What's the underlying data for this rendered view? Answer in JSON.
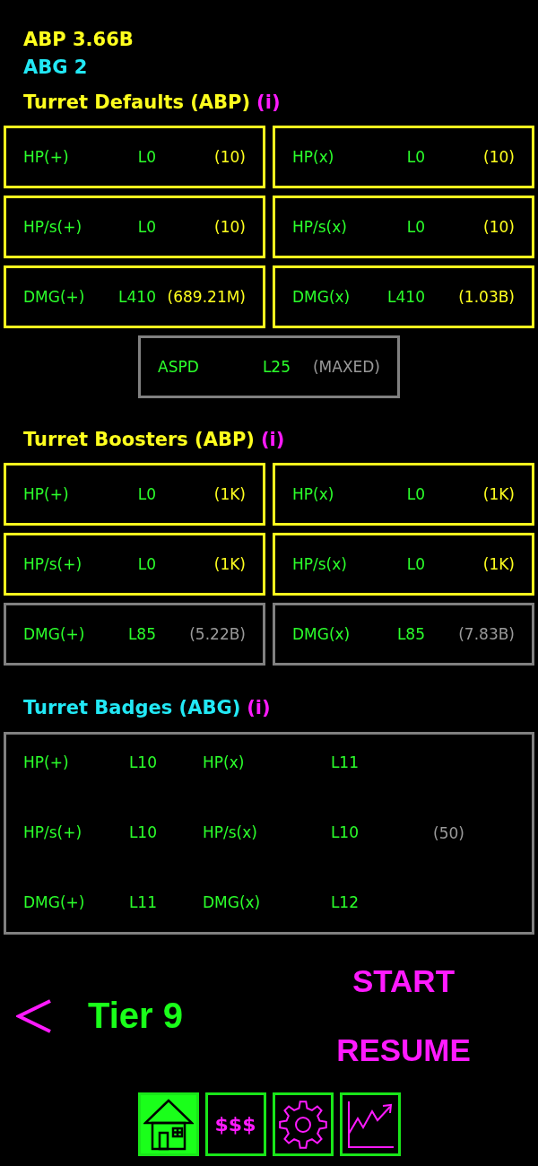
{
  "currencies": [
    {
      "kind": "abp",
      "text": "ABP 3.66B"
    },
    {
      "kind": "abg",
      "text": "ABG 2"
    }
  ],
  "sections": [
    {
      "kind": "abp",
      "title": "Turret Defaults (ABP)",
      "info": "(i)",
      "upgrades": [
        {
          "name": "HP(+)",
          "lvl": "L0",
          "cost": "(10)",
          "affordable": true
        },
        {
          "name": "HP(x)",
          "lvl": "L0",
          "cost": "(10)",
          "affordable": true
        },
        {
          "name": "HP/s(+)",
          "lvl": "L0",
          "cost": "(10)",
          "affordable": true
        },
        {
          "name": "HP/s(x)",
          "lvl": "L0",
          "cost": "(10)",
          "affordable": true
        },
        {
          "name": "DMG(+)",
          "lvl": "L410",
          "cost": "(689.21M)",
          "affordable": true
        },
        {
          "name": "DMG(x)",
          "lvl": "L410",
          "cost": "(1.03B)",
          "affordable": true
        }
      ],
      "extras": [
        {
          "name": "ASPD",
          "lvl": "L25",
          "cost": "(MAXED)",
          "affordable": false
        }
      ]
    },
    {
      "kind": "abp",
      "title": "Turret Boosters (ABP)",
      "info": "(i)",
      "upgrades": [
        {
          "name": "HP(+)",
          "lvl": "L0",
          "cost": "(1K)",
          "affordable": true
        },
        {
          "name": "HP(x)",
          "lvl": "L0",
          "cost": "(1K)",
          "affordable": true
        },
        {
          "name": "HP/s(+)",
          "lvl": "L0",
          "cost": "(1K)",
          "affordable": true
        },
        {
          "name": "HP/s(x)",
          "lvl": "L0",
          "cost": "(1K)",
          "affordable": true
        },
        {
          "name": "DMG(+)",
          "lvl": "L85",
          "cost": "(5.22B)",
          "affordable": false
        },
        {
          "name": "DMG(x)",
          "lvl": "L85",
          "cost": "(7.83B)",
          "affordable": false
        }
      ]
    }
  ],
  "badges": {
    "kind": "abg",
    "title": "Turret Badges (ABG)",
    "info": "(i)",
    "items": [
      {
        "name": "HP(+)",
        "lvl": "L10"
      },
      {
        "name": "HP(x)",
        "lvl": "L11"
      },
      {
        "name": "HP/s(+)",
        "lvl": "L10"
      },
      {
        "name": "HP/s(x)",
        "lvl": "L10"
      },
      {
        "name": "DMG(+)",
        "lvl": "L11"
      },
      {
        "name": "DMG(x)",
        "lvl": "L12"
      }
    ],
    "cost": "(50)",
    "affordable": false
  },
  "tier": {
    "label": "Tier 9"
  },
  "actions": [
    "START",
    "RESUME"
  ],
  "nav": [
    {
      "kind": "home",
      "selected": true
    },
    {
      "kind": "shop",
      "label": "$$$",
      "selected": false
    },
    {
      "kind": "settings",
      "selected": false
    },
    {
      "kind": "stats",
      "selected": false
    }
  ]
}
